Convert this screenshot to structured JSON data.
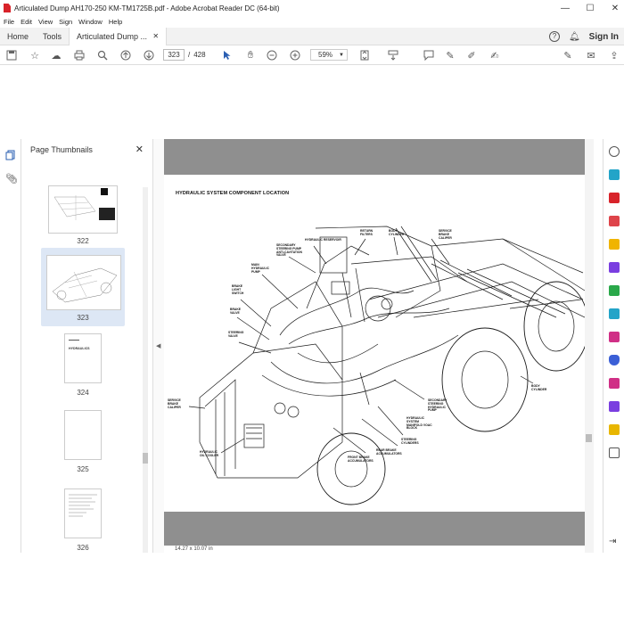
{
  "window": {
    "title": "Articulated Dump AH170-250 KM-TM1725B.pdf - Adobe Acrobat Reader DC (64-bit)",
    "minimize": "—",
    "maximize": "☐",
    "close": "✕"
  },
  "menu": [
    "File",
    "Edit",
    "View",
    "Sign",
    "Window",
    "Help"
  ],
  "tabs": {
    "home": "Home",
    "tools": "Tools",
    "document": "Articulated Dump ...",
    "sign_in": "Sign In"
  },
  "toolbar": {
    "current_page": "323",
    "page_separator": "/",
    "total_pages": "428",
    "zoom": "59%"
  },
  "thumbnails_panel": {
    "title": "Page Thumbnails",
    "close": "✕",
    "pages": [
      {
        "label": "322"
      },
      {
        "label": "323",
        "selected": true
      },
      {
        "label": "324",
        "text": "HYDRAULICS"
      },
      {
        "label": "325"
      },
      {
        "label": "326"
      }
    ]
  },
  "page": {
    "heading": "HYDRAULIC  SYSTEM COMPONENT LOCATION",
    "callouts": {
      "hydraulic_reservoir": "HYDRAULIC RESERVOIR",
      "secondary_steering_pump": "SECONDARY STEERING PUMP ANTI-CAVITATION VALVE",
      "return_filters": "RETURN FILTERS",
      "body_cylinder_top": "BODY CYLINDER",
      "service_brake_caliper_top": "SERVICE BRAKE CALIPER",
      "main_hydraulic_pump": "MAIN HYDRAULIC PUMP",
      "brake_light_switch": "BRAKE LIGHT SWITCH",
      "brake_valve": "BRAKE VALVE",
      "steering_valve": "STEERING VALVE",
      "service_brake_caliper_left": "SERVICE BRAKE CALIPER",
      "body_cylinder_right": "BODY CYLINDER",
      "secondary_steering_hydraulic_pump": "SECONDARY STEERING HYDRAULIC PUMP",
      "hydraulic_system_manifold": "HYDRAULIC SYSTEM MANIFOLD VOAC BLOCK",
      "steering_cylinders": "STEERING CYLINDERS",
      "rear_brake_accumulators": "REAR BRAKE ACCUMULATORS",
      "front_brake_accumulators": "FRONT BRAKE ACCUMULATORS",
      "hydraulic_oil_cooler": "HYDRAULIC OIL COOLER"
    }
  },
  "status": {
    "page_size": "14.27 x 10.07 in"
  }
}
